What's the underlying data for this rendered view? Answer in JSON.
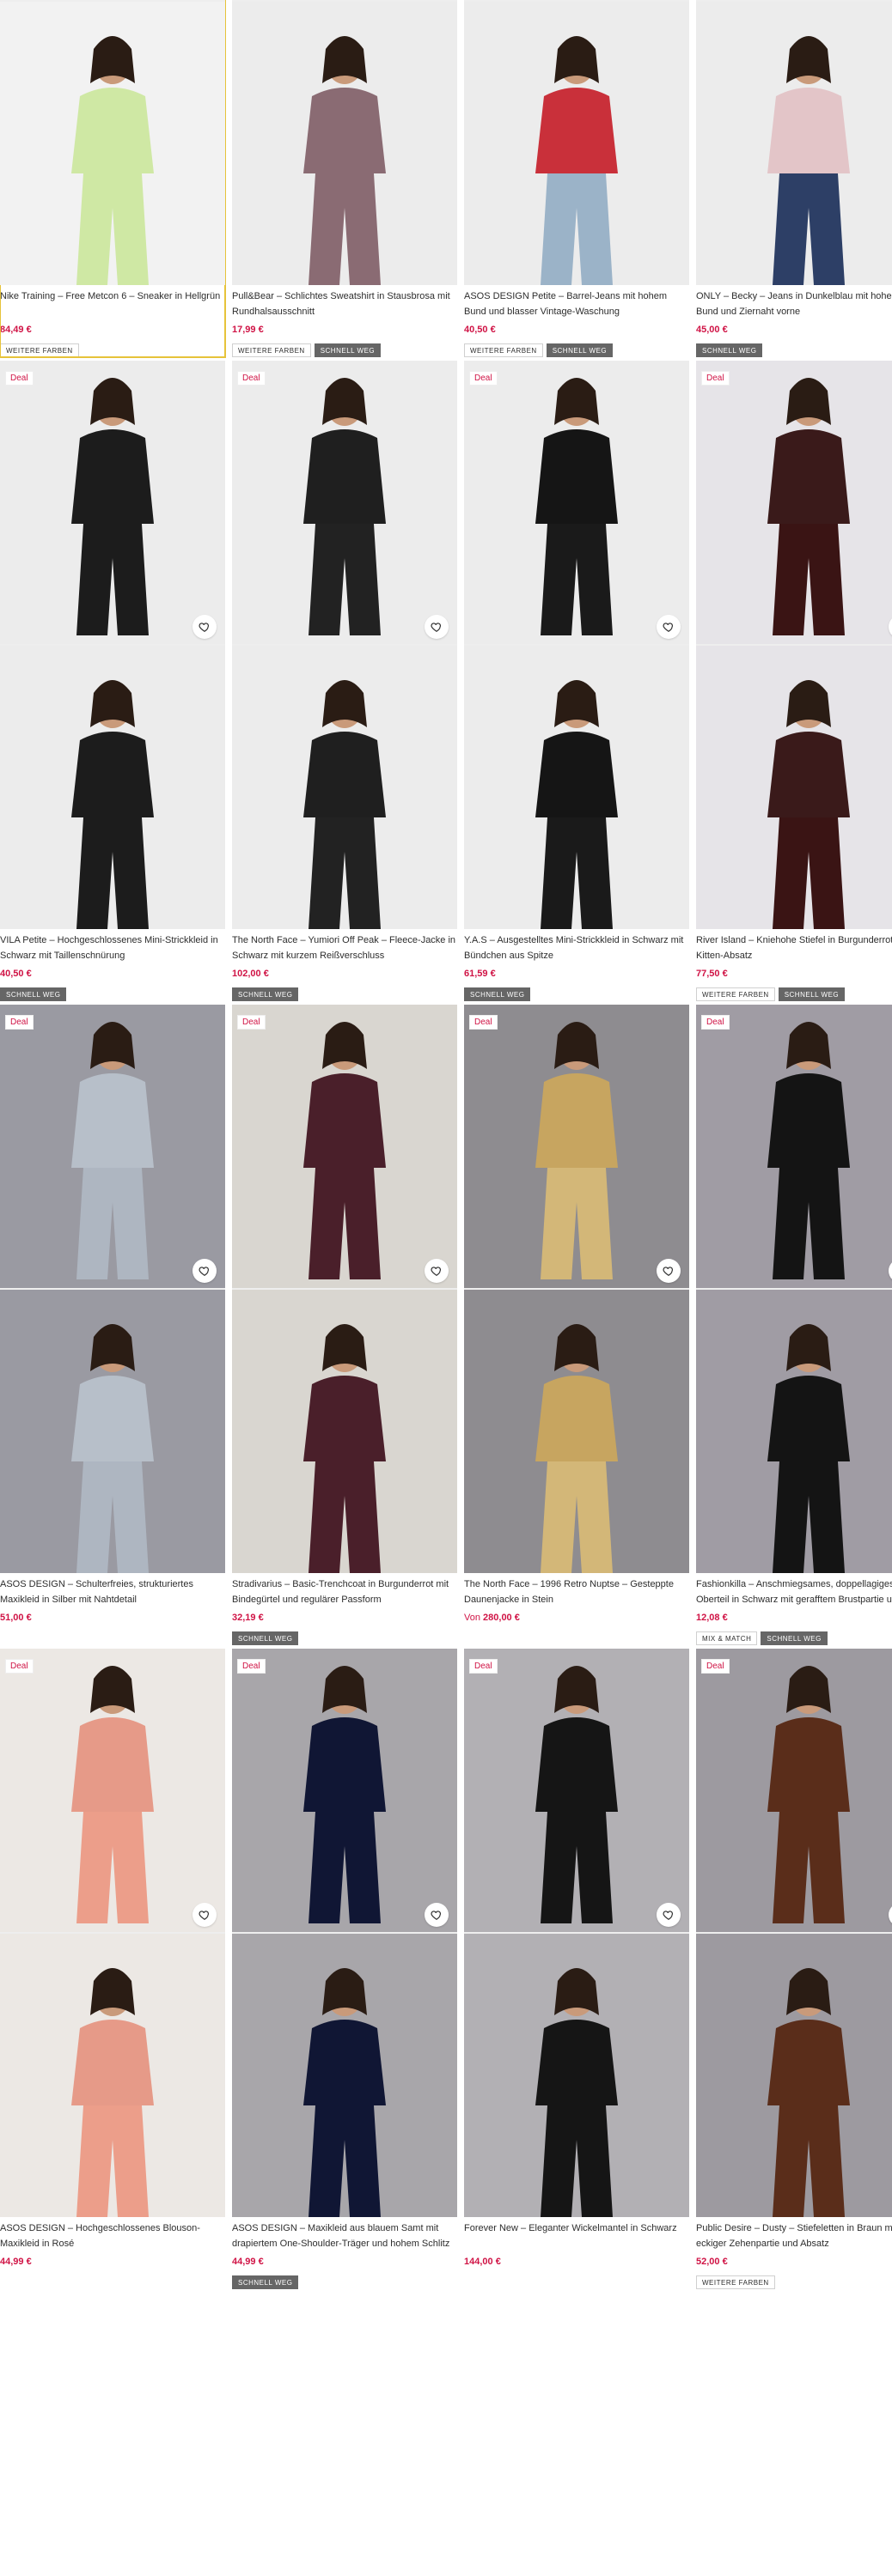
{
  "deal_label": "Deal",
  "colors": {
    "price": "#d01345",
    "deal": "#d01345",
    "selected_outline": "#e6c33a"
  },
  "products": [
    {
      "title": "Nike Training – Free Metcon 6 – Sneaker in Hellgrün",
      "price": "84,49 €",
      "deal": false,
      "tags": [
        "WEITERE FARBEN"
      ],
      "bg": "#f2f2f2",
      "figure": "#cfe8a4",
      "figure2": "#cfe8a4",
      "selected": true
    },
    {
      "title": "Pull&Bear – Schlichtes Sweatshirt in Stausbrosa mit Rundhalsausschnitt",
      "price": "17,99 €",
      "deal": true,
      "tags": [
        "WEITERE FARBEN",
        "SCHNELL WEG"
      ],
      "bg": "#ececec",
      "figure": "#8a6b73",
      "figure2": "#8a6b73"
    },
    {
      "title": "ASOS DESIGN Petite – Barrel-Jeans mit hohem Bund und blasser Vintage-Waschung",
      "price": "40,50 €",
      "deal": true,
      "tags": [
        "WEITERE FARBEN",
        "SCHNELL WEG"
      ],
      "bg": "#ececec",
      "figure": "#c9303a",
      "figure2": "#9bb3c8"
    },
    {
      "title": "ONLY – Becky – Jeans in Dunkelblau mit hohem Bund und Ziernaht vorne",
      "price": "45,00 €",
      "deal": true,
      "tags": [
        "SCHNELL WEG"
      ],
      "bg": "#ececec",
      "figure": "#e3c5c8",
      "figure2": "#2d3f66"
    },
    {
      "title": "VILA Petite – Hochgeschlossenes Mini-Strickkleid in Schwarz mit Taillenschnürung",
      "price": "40,50 €",
      "deal": true,
      "tags": [
        "SCHNELL WEG"
      ],
      "bg": "#ececec",
      "figure": "#1c1c1c",
      "figure2": "#1c1c1c"
    },
    {
      "title": "The North Face – Yumiori Off Peak – Fleece-Jacke in Schwarz mit kurzem Reißverschluss",
      "price": "102,00 €",
      "deal": true,
      "tags": [
        "SCHNELL WEG"
      ],
      "bg": "#ececec",
      "figure": "#1f1f1f",
      "figure2": "#222222"
    },
    {
      "title": "Y.A.S – Ausgestelltes Mini-Strickkleid in Schwarz mit Bündchen aus Spitze",
      "price": "61,59 €",
      "deal": true,
      "tags": [
        "SCHNELL WEG"
      ],
      "bg": "#ececec",
      "figure": "#151515",
      "figure2": "#1a1a1a"
    },
    {
      "title": "River Island – Kniehohe Stiefel in Burgunderrot mit Kitten-Absatz",
      "price": "77,50 €",
      "deal": true,
      "tags": [
        "WEITERE FARBEN",
        "SCHNELL WEG"
      ],
      "bg": "#e6e4e8",
      "figure": "#3a1a1a",
      "figure2": "#3a1414"
    },
    {
      "title": "ASOS DESIGN – Schulterfreies, strukturiertes Maxikleid in Silber mit Nahtdetail",
      "price": "51,00 €",
      "deal": true,
      "tags": [],
      "bg": "#9a9aa2",
      "figure": "#b7bfc9",
      "figure2": "#aeb6c1"
    },
    {
      "title": "Stradivarius – Basic-Trenchcoat in Burgunderrot mit Bindegürtel und regulärer Passform",
      "price": "32,19 €",
      "deal": true,
      "tags": [
        "SCHNELL WEG"
      ],
      "bg": "#d9d6d0",
      "figure": "#4a1f2a",
      "figure2": "#4a1f2a"
    },
    {
      "title": "The North Face – 1996 Retro Nuptse – Gesteppte Daunenjacke in Stein",
      "price": "280,00 €",
      "price_prefix": "Von",
      "deal": true,
      "tags": [],
      "bg": "#8e8c90",
      "figure": "#c7a560",
      "figure2": "#d3b778"
    },
    {
      "title": "Fashionkilla – Anschmiegsames, doppellagiges Oberteil in Schwarz mit gerafftem Brustpartie und",
      "price": "12,08 €",
      "deal": true,
      "tags": [
        "MIX & MATCH",
        "SCHNELL WEG"
      ],
      "bg": "#a09ca4",
      "figure": "#141414",
      "figure2": "#141414"
    },
    {
      "title": "ASOS DESIGN – Hochgeschlossenes Blouson-Maxikleid in Rosé",
      "price": "44,99 €",
      "deal": true,
      "tags": [],
      "bg": "#ece8e4",
      "figure": "#e69a88",
      "figure2": "#ec9e8a"
    },
    {
      "title": "ASOS DESIGN – Maxikleid aus blauem Samt mit drapiertem One-Shoulder-Träger und hohem Schlitz",
      "price": "44,99 €",
      "deal": true,
      "tags": [
        "SCHNELL WEG"
      ],
      "bg": "#a8a6aa",
      "figure": "#101634",
      "figure2": "#101634"
    },
    {
      "title": "Forever New – Eleganter Wickelmantel in Schwarz",
      "price": "144,00 €",
      "deal": true,
      "tags": [],
      "bg": "#b2b0b4",
      "figure": "#151515",
      "figure2": "#151515"
    },
    {
      "title": "Public Desire – Dusty – Stiefeletten in Braun mit eckiger Zehenpartie und Absatz",
      "price": "52,00 €",
      "deal": true,
      "tags": [
        "WEITERE FARBEN"
      ],
      "bg": "#9d9aa0",
      "figure": "#5a2d1a",
      "figure2": "#5a2d1a"
    }
  ]
}
